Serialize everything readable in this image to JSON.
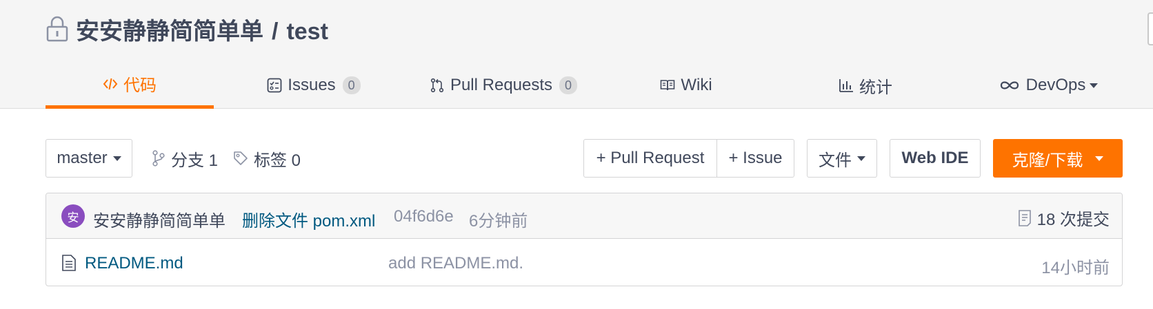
{
  "repo": {
    "owner": "安安静静简简单单",
    "separator": "/",
    "name": "test"
  },
  "tabs": [
    {
      "label": "代码",
      "icon": "code-icon",
      "active": true
    },
    {
      "label": "Issues",
      "icon": "issues-icon",
      "badge": "0"
    },
    {
      "label": "Pull Requests",
      "icon": "pull-request-icon",
      "badge": "0"
    },
    {
      "label": "Wiki",
      "icon": "wiki-book-icon"
    },
    {
      "label": "统计",
      "icon": "bar-chart-icon"
    },
    {
      "label": "DevOps",
      "icon": "infinity-icon",
      "dropdown": true
    }
  ],
  "toolbar": {
    "branch": "master",
    "branches_label": "分支 1",
    "tags_label": "标签 0",
    "new_pr_label": "+ Pull Request",
    "new_issue_label": "+ Issue",
    "file_label": "文件",
    "web_ide_label": "Web IDE",
    "clone_label": "克隆/下载"
  },
  "last_commit": {
    "avatar_text": "安",
    "author": "安安静静简简单单",
    "message": "删除文件 pom.xml",
    "sha": "04f6d6e",
    "time": "6分钟前",
    "count_label": "18 次提交"
  },
  "files": [
    {
      "name": "README.md",
      "message": "add README.md.",
      "time": "14小时前",
      "icon": "file-icon"
    }
  ],
  "colors": {
    "accent": "#fe7300",
    "link": "#005980",
    "avatar": "#8a4dbf"
  }
}
